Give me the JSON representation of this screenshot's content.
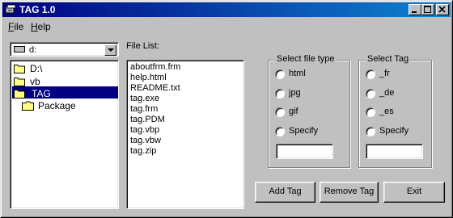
{
  "window": {
    "title": "TAG 1.0"
  },
  "menu": {
    "file_accel": "F",
    "file_rest": "ile",
    "help_accel": "H",
    "help_rest": "elp"
  },
  "drive": {
    "label": "d:"
  },
  "directories": [
    {
      "label": "D:\\",
      "selected": false
    },
    {
      "label": "vb",
      "selected": false
    },
    {
      "label": "TAG",
      "selected": true
    },
    {
      "label": "Package",
      "selected": false
    }
  ],
  "file_list": {
    "label": "File List:",
    "items": [
      "aboutfrm.frm",
      "help.html",
      "README.txt",
      "tag.exe",
      "tag.frm",
      "tag.PDM",
      "tag.vbp",
      "tag.vbw",
      "tag.zip"
    ]
  },
  "file_type": {
    "title": "Select file type",
    "options": [
      "html",
      "jpg",
      "gif",
      "Specify"
    ],
    "specify_value": ""
  },
  "tag": {
    "title": "Select Tag",
    "options": [
      "_fr",
      "_de",
      "_es",
      "Specify"
    ],
    "specify_value": ""
  },
  "buttons": {
    "add": "Add Tag",
    "remove": "Remove Tag",
    "exit": "Exit"
  }
}
